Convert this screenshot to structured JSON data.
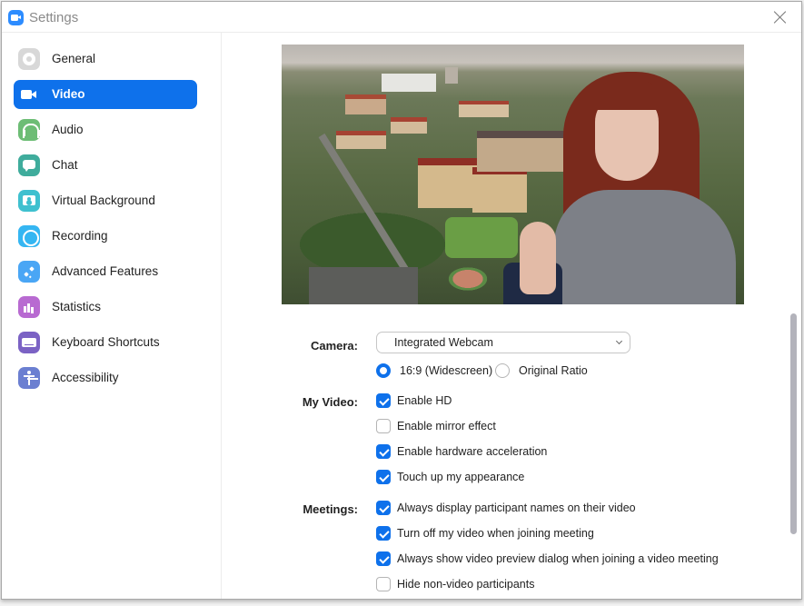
{
  "window": {
    "title": "Settings",
    "app_icon": "zoom-camera-icon",
    "close_icon": "close-icon"
  },
  "colors": {
    "accent": "#0e71eb",
    "checkbox_on": "#0e71eb",
    "scrollbar": "#b3b3bb"
  },
  "sidebar": {
    "active": "Video",
    "items": [
      {
        "label": "General",
        "icon": "gear-icon",
        "color": "#d8d8d8"
      },
      {
        "label": "Video",
        "icon": "video-camera-icon",
        "color": "#0e71eb"
      },
      {
        "label": "Audio",
        "icon": "headphones-icon",
        "color": "#6dbd75"
      },
      {
        "label": "Chat",
        "icon": "chat-bubble-icon",
        "color": "#3fac9c"
      },
      {
        "label": "Virtual Background",
        "icon": "virtual-background-icon",
        "color": "#3fc0cf"
      },
      {
        "label": "Recording",
        "icon": "record-icon",
        "color": "#35b6f2"
      },
      {
        "label": "Advanced Features",
        "icon": "sparkle-icon",
        "color": "#4aa6f5"
      },
      {
        "label": "Statistics",
        "icon": "bar-chart-icon",
        "color": "#b86ad1"
      },
      {
        "label": "Keyboard Shortcuts",
        "icon": "keyboard-icon",
        "color": "#7b62c4"
      },
      {
        "label": "Accessibility",
        "icon": "accessibility-icon",
        "color": "#6b7fd1"
      }
    ]
  },
  "video": {
    "preview_alt": "Camera preview with virtual background of aerial campus view",
    "camera": {
      "label": "Camera:",
      "selected": "Integrated Webcam"
    },
    "aspect": {
      "options": [
        {
          "label": "16:9 (Widescreen)",
          "selected": true
        },
        {
          "label": "Original Ratio",
          "selected": false
        }
      ]
    },
    "my_video": {
      "label": "My Video:",
      "options": [
        {
          "label": "Enable HD",
          "checked": true
        },
        {
          "label": "Enable mirror effect",
          "checked": false
        },
        {
          "label": "Enable hardware acceleration",
          "checked": true
        },
        {
          "label": "Touch up my appearance",
          "checked": true
        }
      ]
    },
    "meetings": {
      "label": "Meetings:",
      "options": [
        {
          "label": "Always display participant names on their video",
          "checked": true
        },
        {
          "label": "Turn off my video when joining meeting",
          "checked": true
        },
        {
          "label": "Always show video preview dialog when joining a video meeting",
          "checked": true
        },
        {
          "label": "Hide non-video participants",
          "checked": false
        }
      ]
    }
  }
}
